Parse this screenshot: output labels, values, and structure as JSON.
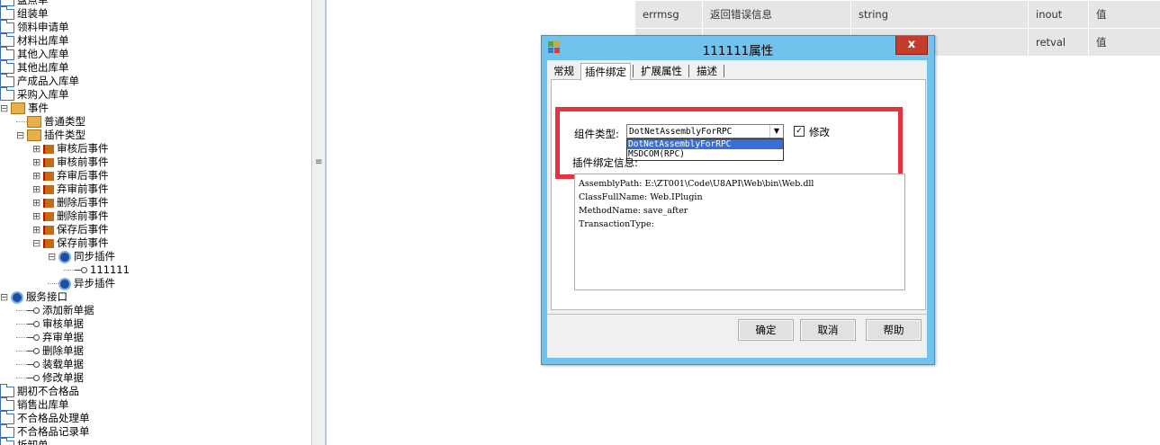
{
  "tree": {
    "items": [
      {
        "label": "盘点单",
        "icon": "folder-icon"
      },
      {
        "label": "组装单",
        "icon": "folder-icon"
      },
      {
        "label": "领料申请单",
        "icon": "folder-icon"
      },
      {
        "label": "材料出库单",
        "icon": "folder-icon"
      },
      {
        "label": "其他入库单",
        "icon": "folder-icon"
      },
      {
        "label": "其他出库单",
        "icon": "folder-icon"
      },
      {
        "label": "产成品入库单",
        "icon": "folder-icon"
      },
      {
        "label": "采购入库单",
        "icon": "folder-icon"
      },
      {
        "label": "事件",
        "icon": "event-folder-icon",
        "expand": "⊟"
      },
      {
        "label": "普通类型",
        "icon": "event-folder-icon"
      },
      {
        "label": "插件类型",
        "icon": "event-folder-icon",
        "expand": "⊟"
      },
      {
        "label": "审核后事件",
        "icon": "event-icon",
        "expand": "⊞"
      },
      {
        "label": "审核前事件",
        "icon": "event-icon",
        "expand": "⊞"
      },
      {
        "label": "弃审后事件",
        "icon": "event-icon",
        "expand": "⊞"
      },
      {
        "label": "弃审前事件",
        "icon": "event-icon",
        "expand": "⊞"
      },
      {
        "label": "删除后事件",
        "icon": "event-icon",
        "expand": "⊞"
      },
      {
        "label": "删除前事件",
        "icon": "event-icon",
        "expand": "⊞"
      },
      {
        "label": "保存后事件",
        "icon": "event-icon",
        "expand": "⊞"
      },
      {
        "label": "保存前事件",
        "icon": "event-icon",
        "expand": "⊟"
      },
      {
        "label": "同步插件",
        "icon": "gear-icon",
        "expand": "⊟"
      },
      {
        "label": "111111",
        "icon": "plugin-icon"
      },
      {
        "label": "异步插件",
        "icon": "gear-icon"
      },
      {
        "label": "服务接口",
        "icon": "gear-icon",
        "expand": "⊟"
      },
      {
        "label": "添加新单据",
        "icon": "plugin-icon"
      },
      {
        "label": "审核单据",
        "icon": "plugin-icon"
      },
      {
        "label": "弃审单据",
        "icon": "plugin-icon"
      },
      {
        "label": "删除单据",
        "icon": "plugin-icon"
      },
      {
        "label": "装载单据",
        "icon": "plugin-icon"
      },
      {
        "label": "修改单据",
        "icon": "plugin-icon"
      },
      {
        "label": "期初不合格品",
        "icon": "folder-icon"
      },
      {
        "label": "销售出库单",
        "icon": "folder-icon"
      },
      {
        "label": "不合格品处理单",
        "icon": "folder-icon"
      },
      {
        "label": "不合格品记录单",
        "icon": "folder-icon"
      },
      {
        "label": "拆卸单",
        "icon": "folder-icon"
      }
    ]
  },
  "splitter": {
    "grip": "≡"
  },
  "grid": {
    "rows": [
      [
        "errmsg",
        "返回错误信息",
        "string",
        "inout",
        "值"
      ],
      [
        "",
        "",
        "",
        "retval",
        "值"
      ]
    ]
  },
  "dialog": {
    "title": "111111属性",
    "close": "x",
    "tabs": [
      "常规",
      "插件绑定",
      "扩展属性",
      "描述"
    ],
    "active_tab": 1,
    "component_type_label": "组件类型:",
    "component_type_value": "DotNetAssemblyForRPC",
    "dropdown_arrow": "▼",
    "options": [
      "DotNetAssemblyForRPC",
      "MSDCOM(RPC)"
    ],
    "modify_checked": "✓",
    "modify_label": "修改",
    "binding_info_label": "插件绑定信息:",
    "binding_info_lines": [
      "AssemblyPath:  E:\\ZT001\\Code\\U8API\\Web\\bin\\Web.dll",
      "ClassFullName:  Web.IPlugin",
      "MethodName:  save_after",
      "TransactionType:"
    ],
    "buttons": {
      "ok": "确定",
      "cancel": "取消",
      "help": "帮助"
    },
    "accent": "#e3343f"
  }
}
